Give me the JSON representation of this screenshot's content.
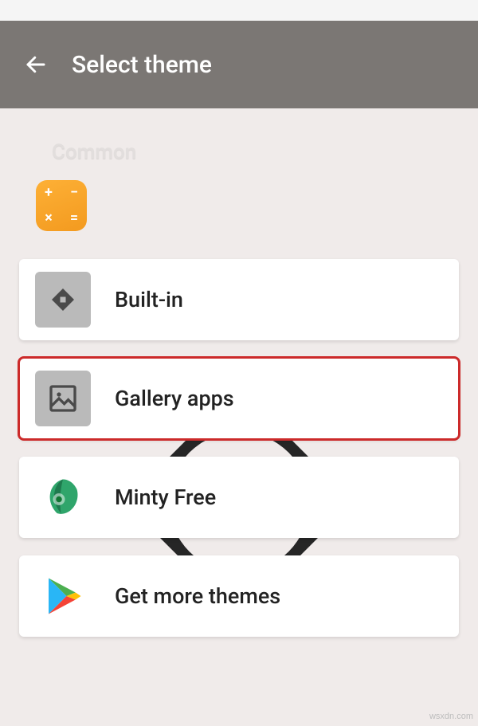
{
  "appbar": {
    "title": "Select theme"
  },
  "section": {
    "label": "Common"
  },
  "items": [
    {
      "label": "Built-in"
    },
    {
      "label": "Gallery apps"
    },
    {
      "label": "Minty Free"
    },
    {
      "label": "Get more themes"
    }
  ],
  "watermark": "wsxdn.com"
}
